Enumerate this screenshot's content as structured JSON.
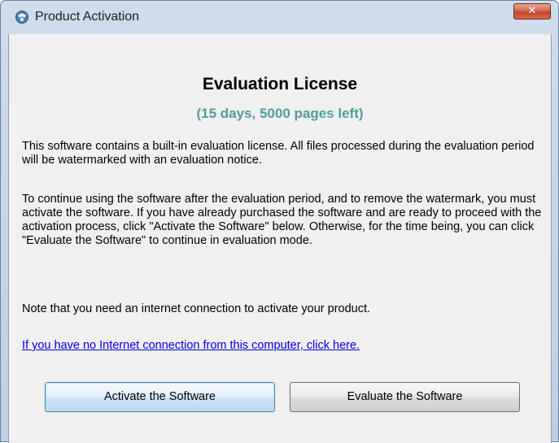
{
  "window": {
    "title": "Product Activation",
    "close_label": "✕"
  },
  "main": {
    "heading": "Evaluation License",
    "subheading": "(15 days, 5000 pages left)",
    "paragraph1": "This software contains a built-in evaluation license.  All files processed during the evaluation period will be watermarked with an evaluation notice.",
    "paragraph2": "To continue using the software after the evaluation period, and to remove the watermark, you must activate the software.  If you have already purchased the software and are ready to proceed with the activation process, click \"Activate the Software\" below.  Otherwise, for the time being, you can click \"Evaluate the Software\" to continue in evaluation mode.",
    "paragraph3": "Note that you need an internet connection to activate your product.",
    "link": "If you have no Internet connection from this computer, click here."
  },
  "buttons": {
    "activate": "Activate the Software",
    "evaluate": "Evaluate the Software"
  },
  "icons": {
    "app": "product-activation-icon",
    "close": "close-icon"
  },
  "colors": {
    "subheading": "#4f9e9a",
    "link": "#0000ee",
    "close_button": "#c2442b"
  }
}
